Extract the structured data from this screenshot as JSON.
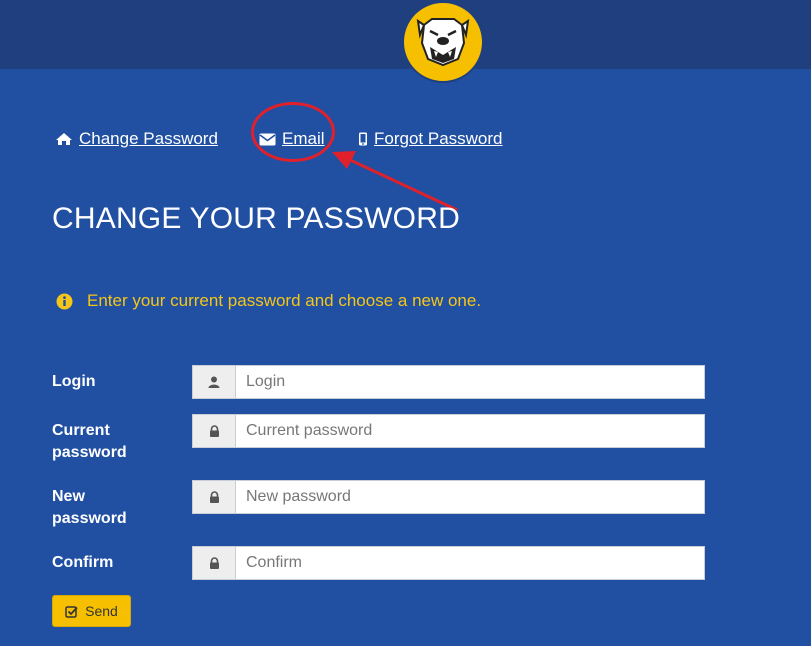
{
  "nav": {
    "change_password": {
      "label": "Change Password",
      "icon": "home-icon"
    },
    "email": {
      "label": "Email",
      "icon": "envelope-icon"
    },
    "forgot_password": {
      "label": "Forgot Password",
      "icon": "mobile-icon"
    }
  },
  "page_title": "CHANGE YOUR PASSWORD",
  "info_message": "Enter your current password and choose a new one.",
  "form": {
    "login": {
      "label": "Login",
      "placeholder": "Login",
      "icon": "user-icon"
    },
    "current_password": {
      "label_line1": "Current",
      "label_line2": "password",
      "placeholder": "Current password",
      "icon": "lock-icon"
    },
    "new_password": {
      "label_line1": "New",
      "label_line2": "password",
      "placeholder": "New password",
      "icon": "lock-icon"
    },
    "confirm": {
      "label": "Confirm",
      "placeholder": "Confirm",
      "icon": "lock-icon"
    },
    "send_label": "Send"
  },
  "colors": {
    "background": "#2150a3",
    "header": "#1f3f7f",
    "accent_yellow": "#f6c000",
    "info_text": "#f5c518",
    "annotation_red": "#e0202a"
  }
}
